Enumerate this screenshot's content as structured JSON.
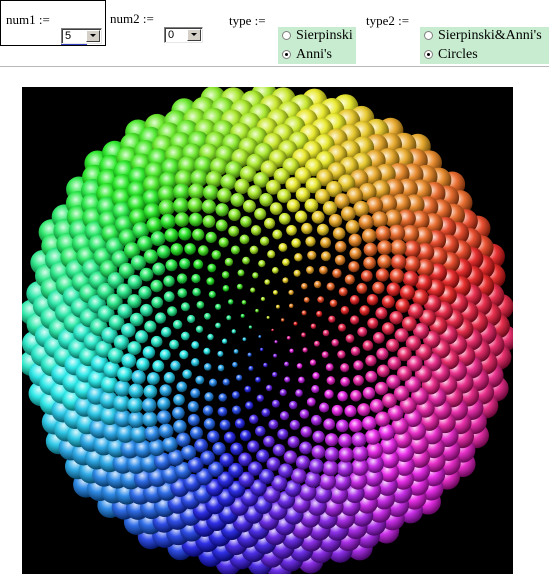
{
  "controls": {
    "num1": {
      "label": "num1 :=",
      "value": "5"
    },
    "num2": {
      "label": "num2 :=",
      "value": "0"
    },
    "type": {
      "label": "type :=",
      "options": [
        {
          "label": "Sierpinski",
          "selected": false
        },
        {
          "label": "Anni's",
          "selected": true
        }
      ]
    },
    "type2": {
      "label": "type2 :=",
      "options": [
        {
          "label": "Sierpinski&Anni's",
          "selected": false
        },
        {
          "label": "Circles",
          "selected": true
        }
      ]
    }
  },
  "colors": {
    "radio_group_bg": "#c8ecd0",
    "plot_bg": "#000000"
  },
  "plot": {
    "pattern": "phyllotaxis spiral of shaded spheres with rainbow hue around the center",
    "sphere_count": 900
  }
}
